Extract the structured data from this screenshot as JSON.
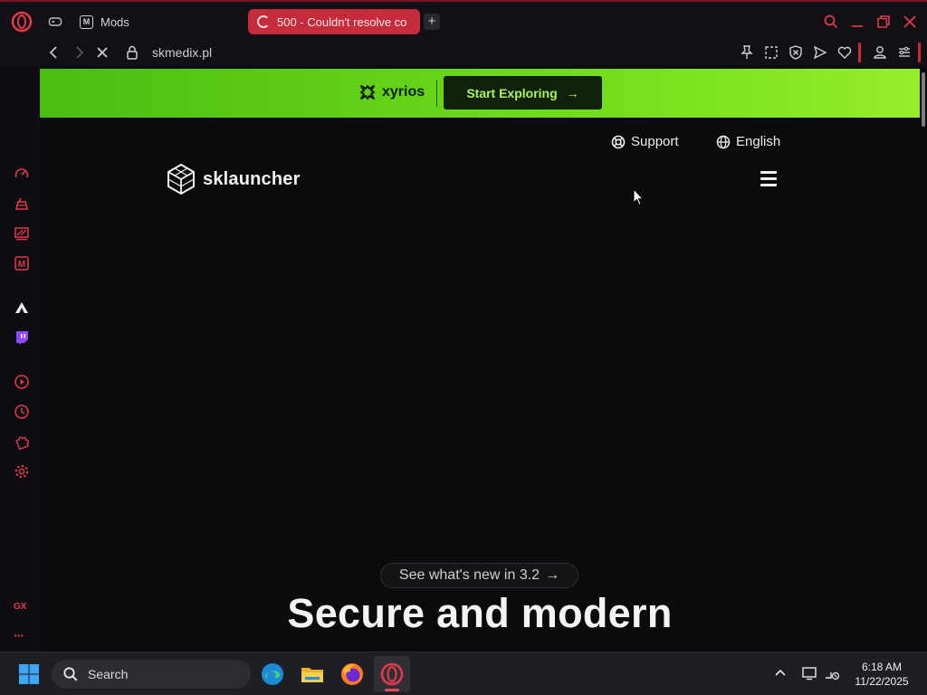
{
  "browser": {
    "tabs": [
      {
        "label": "Mods",
        "icon": "m-site-icon"
      },
      {
        "label": "500 - Couldn't resolve co",
        "icon": "loading-spinner-icon",
        "active": true
      }
    ],
    "url": "skmedix.pl",
    "accent_color": "#c42b3b"
  },
  "sidebar": {
    "items": [
      "speed-dial-icon",
      "gx-corner-icon",
      "twitch-alt-icon",
      "m-site-icon",
      "extension-icon",
      "twitch-icon",
      "player-icon",
      "history-icon",
      "extensions-icon",
      "settings-icon",
      "gx-icon",
      "more-icon"
    ],
    "gx_label": "GX",
    "more_label": "···"
  },
  "page": {
    "promo": {
      "brand": "xyrios",
      "button_label": "Start Exploring",
      "button_arrow": "→",
      "brand_color": "#6fdc1b"
    },
    "nav": {
      "support_label": "Support",
      "language_label": "English"
    },
    "logo_text": "sklauncher",
    "whatsnew_label": "See what's new in 3.2",
    "whatsnew_arrow": "→",
    "headline": "Secure and modern"
  },
  "taskbar": {
    "search_label": "Search",
    "time": "6:18 AM",
    "date": "11/22/2025",
    "apps": [
      "windows-start-icon",
      "edge-icon",
      "file-explorer-icon",
      "firefox-icon",
      "opera-gx-icon"
    ]
  }
}
